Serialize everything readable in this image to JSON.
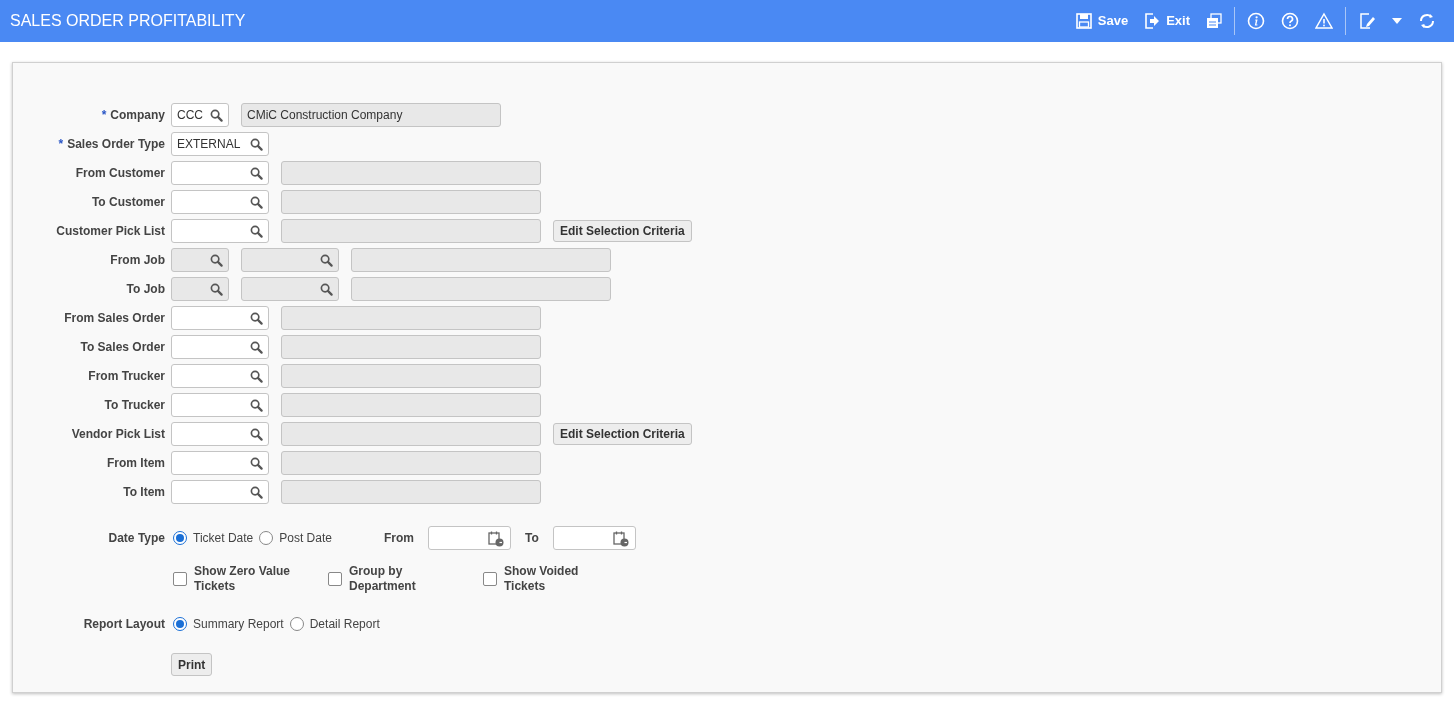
{
  "header": {
    "title": "SALES ORDER PROFITABILITY",
    "actions": [
      {
        "kind": "save",
        "label": "Save"
      },
      {
        "kind": "exit",
        "label": "Exit"
      },
      {
        "kind": "copies"
      },
      {
        "kind": "divider"
      },
      {
        "kind": "info"
      },
      {
        "kind": "help"
      },
      {
        "kind": "warning"
      },
      {
        "kind": "divider"
      },
      {
        "kind": "edit"
      },
      {
        "kind": "caret"
      },
      {
        "kind": "refresh"
      }
    ]
  },
  "rows": [
    {
      "label": "Company",
      "required_mark": "*",
      "fields": [
        {
          "kind": "code",
          "value": "CCC",
          "disabled": false
        },
        {
          "kind": "description",
          "value": "CMiC Construction Company",
          "disabled": true
        }
      ]
    },
    {
      "label": "Sales Order Type",
      "required_mark": "*",
      "fields": [
        {
          "kind": "lookup",
          "value": "EXTERNAL",
          "disabled": false
        }
      ]
    },
    {
      "label": "From Customer",
      "fields": [
        {
          "kind": "lookup",
          "disabled": false
        },
        {
          "kind": "description",
          "disabled": true
        }
      ]
    },
    {
      "label": "To Customer",
      "fields": [
        {
          "kind": "lookup",
          "disabled": false
        },
        {
          "kind": "description",
          "disabled": true
        }
      ]
    },
    {
      "label": "Customer Pick List",
      "fields": [
        {
          "kind": "lookup",
          "disabled": false
        },
        {
          "kind": "description",
          "disabled": true
        },
        {
          "kind": "button",
          "label": "Edit Selection Criteria"
        }
      ]
    },
    {
      "label": "From Job",
      "fields": [
        {
          "kind": "code",
          "disabled": true
        },
        {
          "kind": "lookup",
          "disabled": true
        },
        {
          "kind": "description",
          "disabled": true
        }
      ]
    },
    {
      "label": "To Job",
      "fields": [
        {
          "kind": "code",
          "disabled": true
        },
        {
          "kind": "lookup",
          "disabled": true
        },
        {
          "kind": "description",
          "disabled": true
        }
      ]
    },
    {
      "label": "From Sales Order",
      "fields": [
        {
          "kind": "lookup",
          "disabled": false
        },
        {
          "kind": "description",
          "disabled": true
        }
      ]
    },
    {
      "label": "To Sales Order",
      "fields": [
        {
          "kind": "lookup",
          "disabled": false
        },
        {
          "kind": "description",
          "disabled": true
        }
      ]
    },
    {
      "label": "From Trucker",
      "fields": [
        {
          "kind": "lookup",
          "disabled": false
        },
        {
          "kind": "description",
          "disabled": true
        }
      ]
    },
    {
      "label": "To Trucker",
      "fields": [
        {
          "kind": "lookup",
          "disabled": false
        },
        {
          "kind": "description",
          "disabled": true
        }
      ]
    },
    {
      "label": "Vendor Pick List",
      "fields": [
        {
          "kind": "lookup",
          "disabled": false
        },
        {
          "kind": "description",
          "disabled": true
        },
        {
          "kind": "button",
          "label": "Edit Selection Criteria"
        }
      ]
    },
    {
      "label": "From Item",
      "fields": [
        {
          "kind": "lookup",
          "disabled": false
        },
        {
          "kind": "description",
          "disabled": true
        }
      ]
    },
    {
      "label": "To Item",
      "fields": [
        {
          "kind": "lookup",
          "disabled": false
        },
        {
          "kind": "description",
          "disabled": true
        }
      ]
    }
  ],
  "date_type": {
    "label": "Date Type",
    "options": [
      {
        "label": "Ticket Date",
        "selected": true
      },
      {
        "label": "Post Date",
        "selected": false
      }
    ],
    "from_label": "From",
    "to_label": "To"
  },
  "checkboxes": [
    {
      "label": "Show Zero Value Tickets",
      "checked": false
    },
    {
      "label": "Group by Department",
      "checked": false
    },
    {
      "label": "Show Voided Tickets",
      "checked": false
    }
  ],
  "report_layout": {
    "label": "Report Layout",
    "options": [
      {
        "label": "Summary Report",
        "selected": true
      },
      {
        "label": "Detail Report",
        "selected": false
      }
    ]
  },
  "print_button": "Print"
}
